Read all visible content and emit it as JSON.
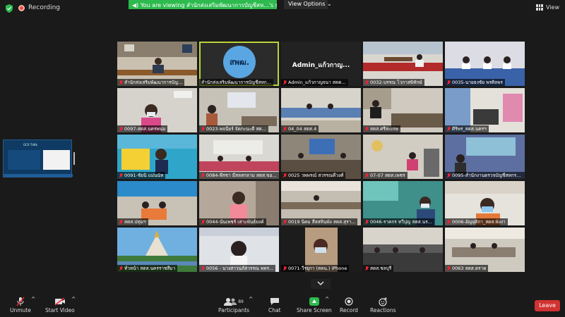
{
  "top": {
    "recording": "Recording",
    "banner": "You are viewing สำนักส่งเสริมพัฒนาการบัญชีสห...'s screen",
    "view_options": "View Options",
    "view": "View"
  },
  "tiles": [
    {
      "name": "สำนักส่งเสริมพัฒนาการบัญ...",
      "muted": true
    },
    {
      "name": "สำนักส่งเสริมพัฒนาการบัญชีสหก...",
      "muted": false,
      "logo_text": "สพฒ."
    },
    {
      "name": "Admin_แก้วกาญจนา สคต...",
      "muted": true,
      "big_name": "Admin_แก้วกาญ..."
    },
    {
      "name": "0032-บรรณ โวกาสพิทักษ์",
      "muted": true
    },
    {
      "name": "0035-นายธงชัย พรศิลพร",
      "muted": true
    },
    {
      "name": "0097-สตส.นครพนม",
      "muted": true
    },
    {
      "name": "0023-พจนียร์ จัดกะนะดี สต...",
      "muted": true
    },
    {
      "name": "04_04 สตส.4",
      "muted": true
    },
    {
      "name": "สตส.ศรีสะเกษ",
      "muted": true
    },
    {
      "name": "ศิริพร_สตส.นครฯ",
      "muted": true
    },
    {
      "name": "0091-ชัยนิ แม่นนัท",
      "muted": true
    },
    {
      "name": "0084-พีรชา มีสลสกลาม สตส.ขอ...",
      "muted": true
    },
    {
      "name": "0025 วพพรณ์ สวรรณคีวงศ์",
      "muted": true
    },
    {
      "name": "07-07 สตส.เพชร",
      "muted": true
    },
    {
      "name": "0095-สำนักงานตรวจบัญชีสหกรณ์...",
      "muted": true
    },
    {
      "name": "สตส.ปทุมฯ",
      "muted": true
    },
    {
      "name": "0044-นั่นเพชร์ เสาะพันธ์ยงค์",
      "muted": true
    },
    {
      "name": "0019 นิคม สีสสทินพัง สตส.สุรา...",
      "muted": true
    },
    {
      "name": "0046-ราคกร ทวีปุญ สตส.นร...",
      "muted": true
    },
    {
      "name": "0006-อัญยุติกา_สตส.พังงา",
      "muted": true
    },
    {
      "name": "ทั่วหน้า สตส.นครราชสีมา",
      "muted": true
    },
    {
      "name": "0056 - นางสาวนภัสวรรณ พทร...",
      "muted": true
    },
    {
      "name": "0071-วีรยุกา (สคน.) iPhone",
      "muted": true
    },
    {
      "name": "สตส.ชลบุรี",
      "muted": true
    },
    {
      "name": "0063 สตส.ตราด",
      "muted": true
    }
  ],
  "share_thumb": {
    "label": "GCX Tdltk"
  },
  "toolbar": {
    "unmute": "Unmute",
    "start_video": "Start Video",
    "participants": "Participants",
    "participants_count": "89",
    "chat": "Chat",
    "share_screen": "Share Screen",
    "record": "Record",
    "reactions": "Reactions",
    "leave": "Leave"
  },
  "colors": {
    "green": "#2dba4e",
    "leave": "#d13232",
    "active_border": "#b9d43a"
  }
}
